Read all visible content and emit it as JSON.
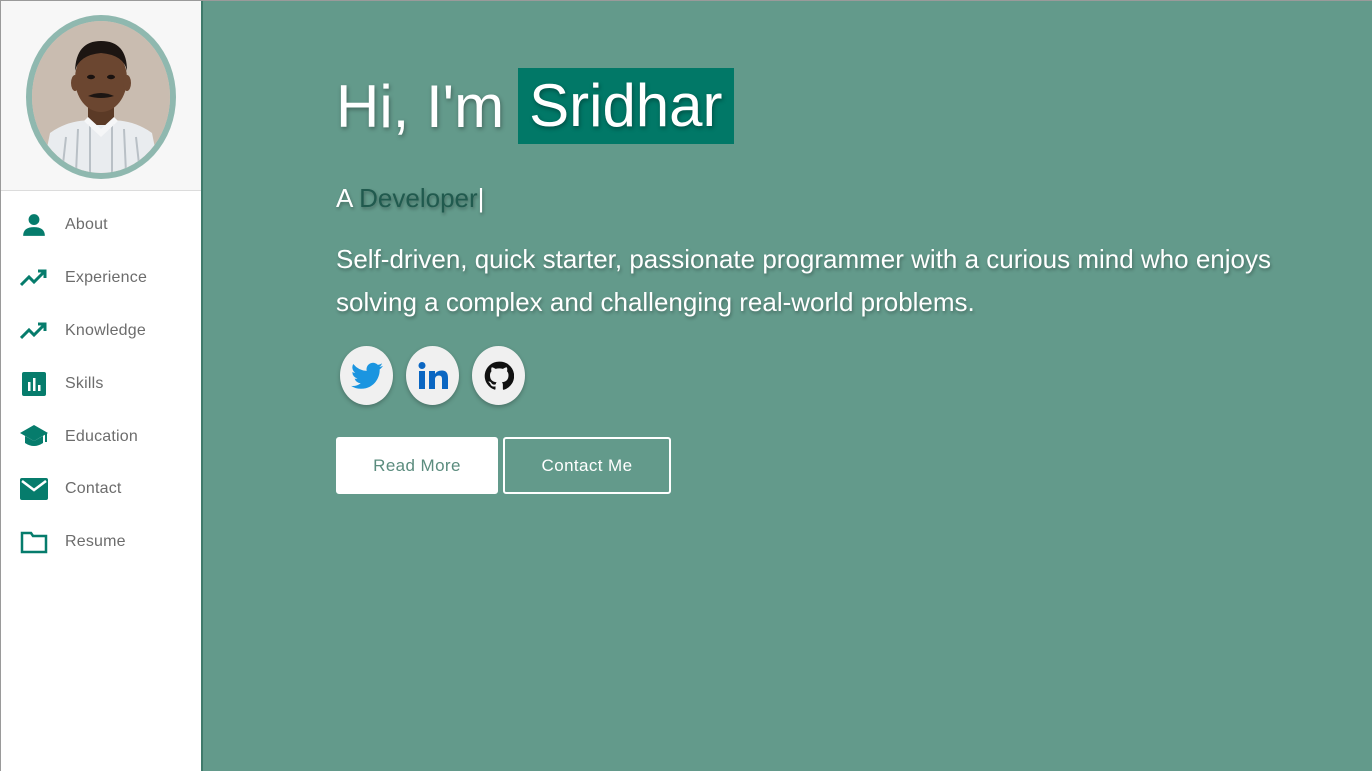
{
  "sidebar": {
    "profile": {
      "avatar_icon": "profile-photo"
    },
    "items": [
      {
        "label": "About",
        "icon": "person-icon"
      },
      {
        "label": "Experience",
        "icon": "trending-up-icon"
      },
      {
        "label": "Knowledge",
        "icon": "trending-up-icon"
      },
      {
        "label": "Skills",
        "icon": "bar-chart-icon"
      },
      {
        "label": "Education",
        "icon": "graduation-cap-icon"
      },
      {
        "label": "Contact",
        "icon": "mail-icon"
      },
      {
        "label": "Resume",
        "icon": "folder-icon"
      }
    ]
  },
  "hero": {
    "greeting_prefix": "Hi, I'm",
    "name": "Sridhar",
    "role_prefix": "A",
    "role": "Developer",
    "caret": "|",
    "description": "Self-driven, quick starter, passionate programmer with a curious mind who enjoys solving a complex and challenging real-world problems.",
    "socials": [
      {
        "name": "twitter",
        "icon": "twitter-icon"
      },
      {
        "name": "linkedin",
        "icon": "linkedin-icon"
      },
      {
        "name": "github",
        "icon": "github-icon"
      }
    ],
    "read_more_label": "Read More",
    "contact_label": "Contact Me"
  },
  "colors": {
    "accent": "#017867",
    "main_background": "#639a8b",
    "nav_icon": "#067c6c",
    "twitter": "#1b95e0",
    "linkedin": "#0a66c2",
    "github": "#111111"
  }
}
